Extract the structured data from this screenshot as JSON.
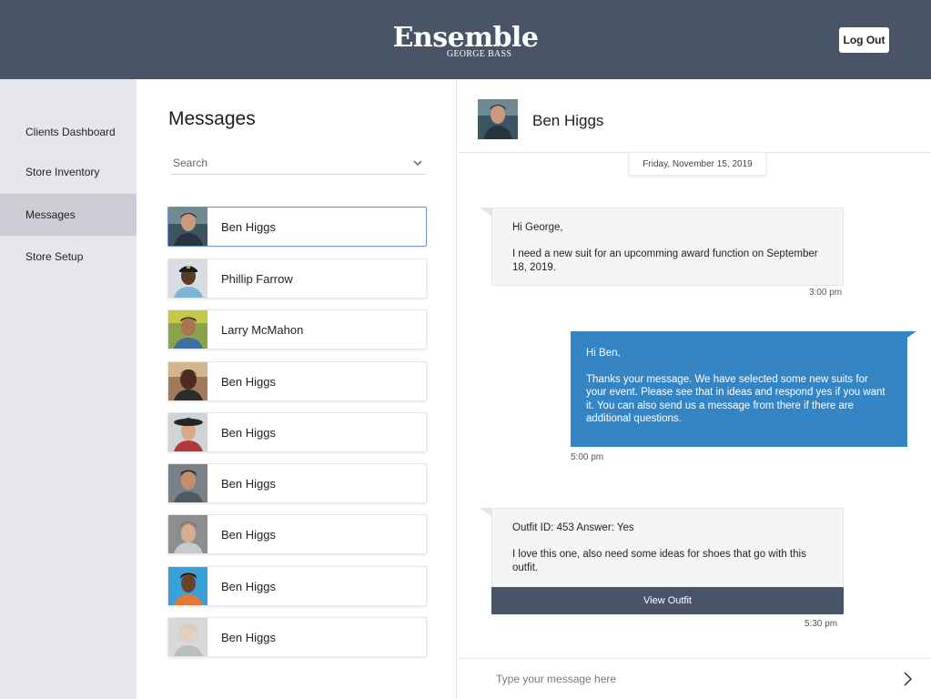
{
  "header": {
    "brand_name": "Ensemble",
    "brand_sub": "GEORGE BASS",
    "logout_label": "Log Out",
    "color": "#4a5467"
  },
  "sidebar": {
    "items": [
      {
        "label": "Clients Dashboard",
        "active": false
      },
      {
        "label": "Store Inventory",
        "active": false
      },
      {
        "label": "Messages",
        "active": true
      },
      {
        "label": "Store Setup",
        "active": false
      }
    ]
  },
  "messages_list": {
    "title": "Messages",
    "search_placeholder": "Search",
    "contacts": [
      {
        "name": "Ben Higgs",
        "selected": true
      },
      {
        "name": "Phillip Farrow",
        "selected": false
      },
      {
        "name": "Larry McMahon",
        "selected": false
      },
      {
        "name": "Ben Higgs",
        "selected": false
      },
      {
        "name": "Ben Higgs",
        "selected": false
      },
      {
        "name": "Ben Higgs",
        "selected": false
      },
      {
        "name": "Ben Higgs",
        "selected": false
      },
      {
        "name": "Ben Higgs",
        "selected": false
      },
      {
        "name": "Ben Higgs",
        "selected": false
      }
    ]
  },
  "chat": {
    "contact_name": "Ben Higgs",
    "date": "Friday,  November 15, 2019",
    "messages": [
      {
        "direction": "incoming",
        "lines": [
          "Hi George,",
          "I need a new suit for an upcomming award function on September 18, 2019."
        ],
        "time": "3:00 pm"
      },
      {
        "direction": "outgoing",
        "lines": [
          "Hi Ben,",
          "Thanks your message. We have selected some new suits for your event. Please see that in ideas and respond yes if you want it.  You can also send us a message from there if there are additional questions."
        ],
        "time": "5:00 pm"
      },
      {
        "direction": "incoming",
        "lines": [
          "Outfit ID: 453   Answer: Yes",
          "I love this one, also need some ideas for shoes that go with this outfit."
        ],
        "time": "5:30 pm",
        "button_label": "View Outfit"
      }
    ],
    "compose_placeholder": "Type your message here",
    "accent_color": "#3585c5"
  }
}
